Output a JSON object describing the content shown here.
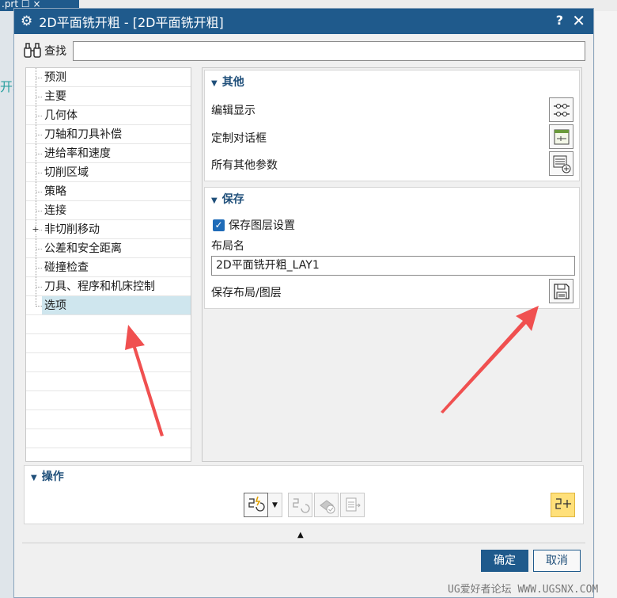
{
  "background": {
    "tab_text": ".prt ☐ ×",
    "side_text": "开粗"
  },
  "window": {
    "title": "2D平面铣开粗 - [2D平面铣开粗]",
    "help": "?",
    "close": "✕",
    "title_color": "#1f5a8c"
  },
  "find": {
    "label": "查找",
    "value": ""
  },
  "tree": {
    "items": [
      {
        "label": "预测"
      },
      {
        "label": "主要"
      },
      {
        "label": "几何体"
      },
      {
        "label": "刀轴和刀具补偿"
      },
      {
        "label": "进给率和速度"
      },
      {
        "label": "切削区域"
      },
      {
        "label": "策略"
      },
      {
        "label": "连接"
      },
      {
        "label": "非切削移动",
        "expander": "+"
      },
      {
        "label": "公差和安全距离"
      },
      {
        "label": "碰撞检查"
      },
      {
        "label": "刀具、程序和机床控制"
      },
      {
        "label": "选项"
      }
    ],
    "selected": "选项"
  },
  "other_group": {
    "title": "其他",
    "edit_display": "编辑显示",
    "customize_dialog": "定制对话框",
    "all_other_params": "所有其他参数"
  },
  "save_group": {
    "title": "保存",
    "save_layer_settings": "保存图层设置",
    "save_layer_checked": true,
    "layout_name_label": "布局名",
    "layout_name_value": "2D平面铣开粗_LAY1",
    "save_layout_label": "保存布局/图层"
  },
  "actions": {
    "title": "操作"
  },
  "buttons": {
    "ok": "确定",
    "cancel": "取消"
  },
  "watermark": "UG爱好者论坛 WWW.UGSNX.COM",
  "colors": {
    "accent": "#1f5a8c",
    "selection": "#cfe6ee",
    "annotation_arrow": "#f05050",
    "highlight_tool": "#ffe07a"
  }
}
